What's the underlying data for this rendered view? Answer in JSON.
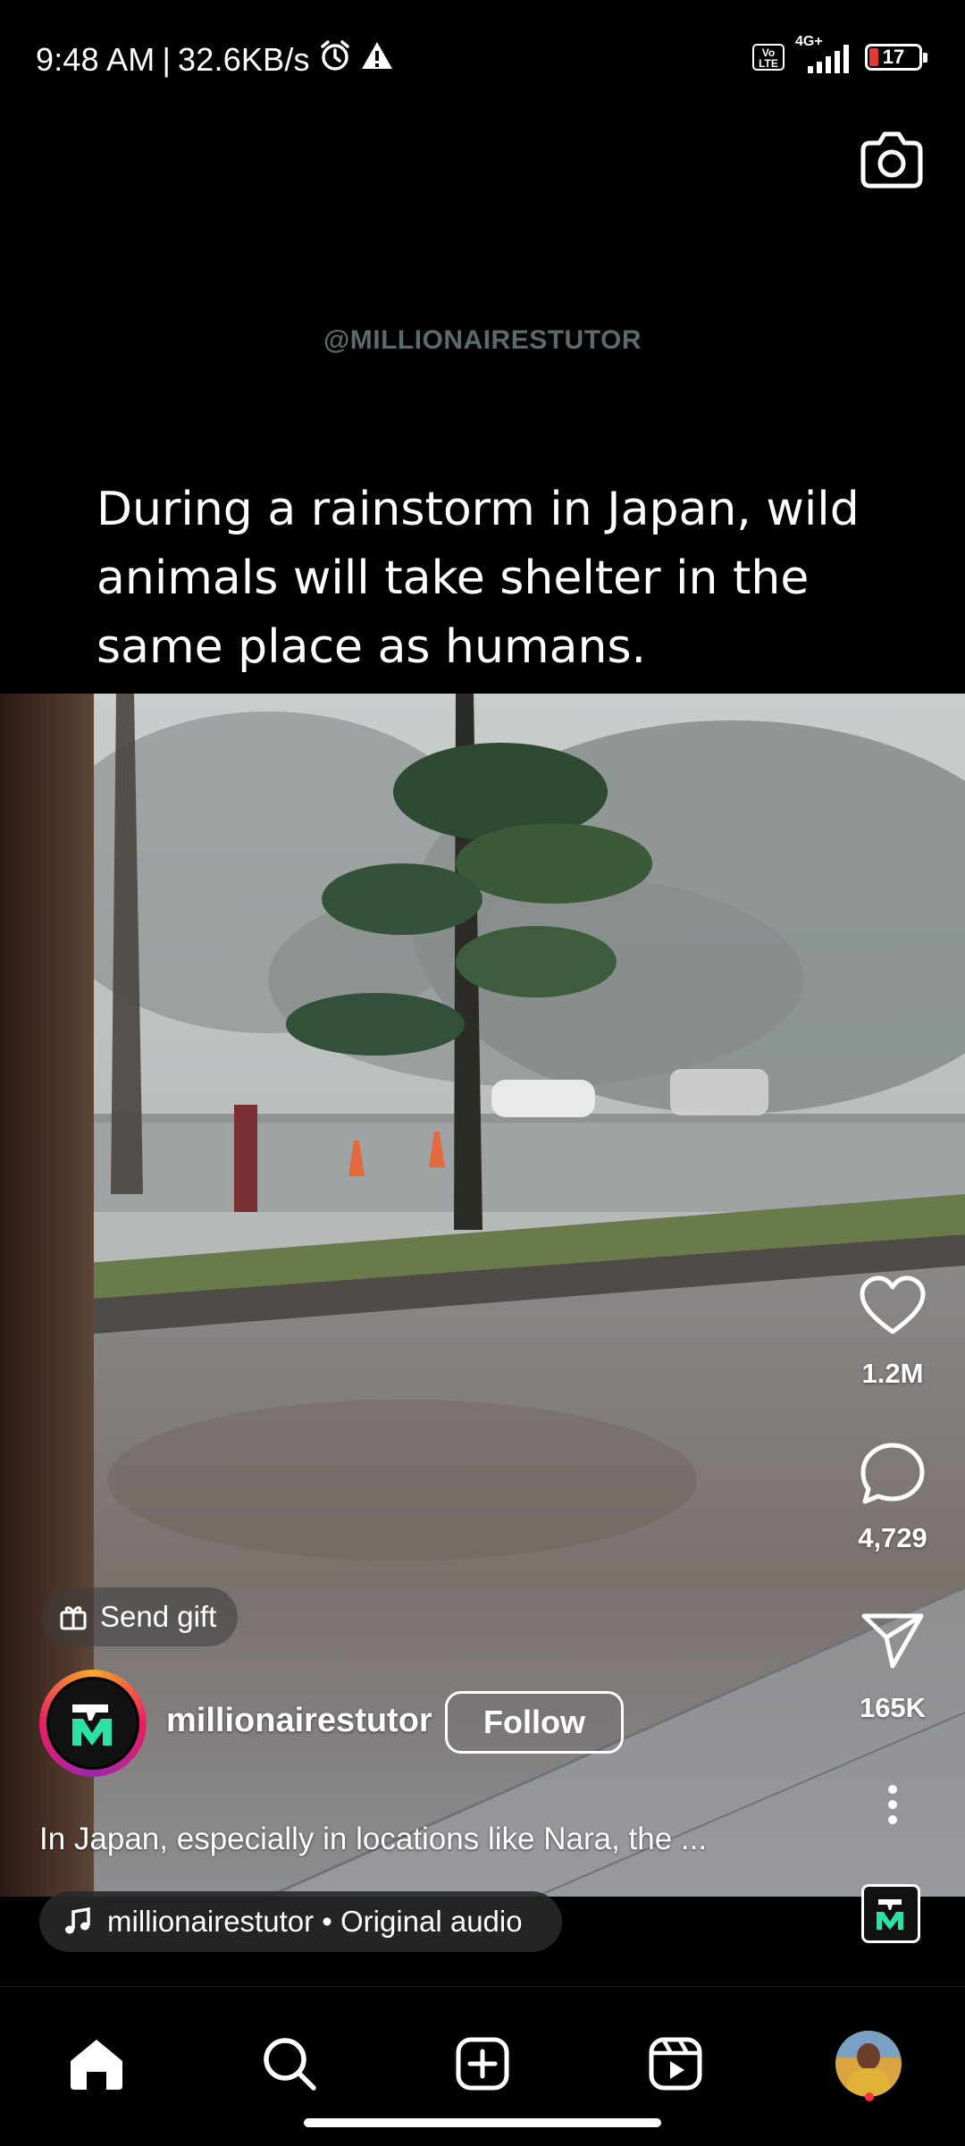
{
  "status_bar": {
    "time": "9:48 AM",
    "separator": "|",
    "network_speed": "32.6KB/s",
    "volte_label": "Vo\nLTE",
    "network_type": "4G+",
    "battery_level": "17",
    "icons": [
      "alarm-icon",
      "warning-icon",
      "volte-icon",
      "signal-icon",
      "battery-icon"
    ]
  },
  "header": {
    "camera_icon": "camera-icon"
  },
  "video": {
    "watermark": "@MILLIONAIRESTUTOR",
    "caption_overlay": "During a rainstorm in Japan, wild animals will take shelter in the same place as humans."
  },
  "actions": {
    "likes": "1.2M",
    "comments": "4,729",
    "shares": "165K",
    "icons": [
      "heart-icon",
      "comment-icon",
      "share-icon",
      "more-icon"
    ]
  },
  "post": {
    "send_gift_label": "Send gift",
    "username": "millionairestutor",
    "follow_label": "Follow",
    "caption": "In Japan, especially in locations like Nara, the ...",
    "audio_label": "millionairestutor • Original audio"
  },
  "bottom_nav": {
    "items": [
      "home",
      "search",
      "create",
      "reels",
      "profile"
    ]
  },
  "colors": {
    "background": "#000000",
    "avatar_ring": [
      "#f9a825",
      "#e91e63",
      "#9c27b0"
    ],
    "logo_accent": "#2de2a6",
    "notification_dot": "#ff3040",
    "battery_low": "#e53935"
  }
}
